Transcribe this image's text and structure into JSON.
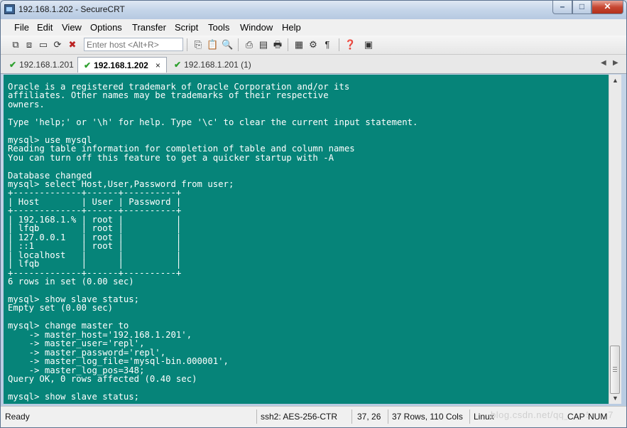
{
  "window": {
    "title": "192.168.1.202 - SecureCRT"
  },
  "menubar": [
    "File",
    "Edit",
    "View",
    "Options",
    "Transfer",
    "Script",
    "Tools",
    "Window",
    "Help"
  ],
  "toolbar": {
    "host_placeholder": "Enter host <Alt+R>"
  },
  "tabs": [
    {
      "label": "192.168.1.201",
      "active": false
    },
    {
      "label": "192.168.1.202",
      "active": true,
      "close": "×"
    },
    {
      "label": "192.168.1.201 (1)",
      "active": false
    }
  ],
  "terminal": {
    "bg_color": "#068479",
    "lines": [
      "Oracle is a registered trademark of Oracle Corporation and/or its",
      "affiliates. Other names may be trademarks of their respective",
      "owners.",
      "",
      "Type 'help;' or '\\h' for help. Type '\\c' to clear the current input statement.",
      "",
      "mysql> use mysql",
      "Reading table information for completion of table and column names",
      "You can turn off this feature to get a quicker startup with -A",
      "",
      "Database changed",
      "mysql> select Host,User,Password from user;",
      "+-------------+------+----------+",
      "| Host        | User | Password |",
      "+-------------+------+----------+",
      "| 192.168.1.% | root |          |",
      "| lfqb        | root |          |",
      "| 127.0.0.1   | root |          |",
      "| ::1         | root |          |",
      "| localhost   |      |          |",
      "| lfqb        |      |          |",
      "+-------------+------+----------+",
      "6 rows in set (0.00 sec)",
      "",
      "mysql> show slave status;",
      "Empty set (0.00 sec)",
      "",
      "mysql> change master to",
      "    -> master_host='192.168.1.201',",
      "    -> master_user='repl',",
      "    -> master_password='repl',",
      "    -> master_log_file='mysql-bin.000001',",
      "    -> master_log_pos=348;",
      "Query OK, 0 rows affected (0.40 sec)",
      "",
      "mysql> show slave status;"
    ]
  },
  "statusbar": {
    "ready": "Ready",
    "encryption": "ssh2: AES-256-CTR",
    "cursor": "37, 26",
    "size": "37 Rows, 110 Cols",
    "term_type": "Linux",
    "watermark": "blog.csdn.net/qq_35956067",
    "caps": "CAP",
    "num": "NUM"
  }
}
